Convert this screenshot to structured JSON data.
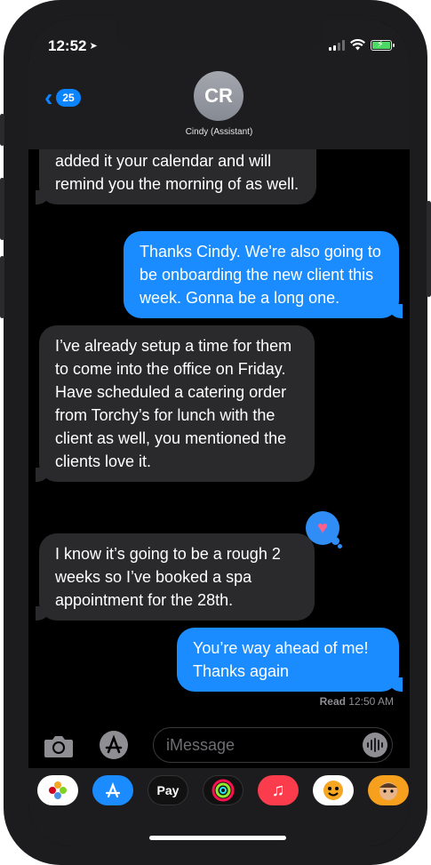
{
  "status_bar": {
    "time": "12:52",
    "location_icon": "location-arrow-icon",
    "battery_color": "#4cd964"
  },
  "header": {
    "back_badge": "25",
    "avatar_initials": "CR",
    "contact_name": "Cindy (Assistant)"
  },
  "messages": [
    {
      "direction": "incoming",
      "text": "added it your calendar and will remind you the morning of as well."
    },
    {
      "direction": "outgoing",
      "text": "Thanks Cindy. We're also going to be onboarding the new client this week. Gonna be a long one."
    },
    {
      "direction": "incoming",
      "text": "I’ve already setup a time for them to come into the office on Friday. Have scheduled a catering order from Torchy’s for lunch with the client as well, you mentioned the clients love it."
    },
    {
      "direction": "incoming",
      "text": "I know it’s going to be a rough 2 weeks so I’ve booked a spa appointment for the 28th.",
      "tapback": "heart-icon"
    },
    {
      "direction": "outgoing",
      "text": "You’re way ahead of me! Thanks again"
    }
  ],
  "read_receipt": {
    "label": "Read",
    "time": "12:50 AM"
  },
  "composer": {
    "placeholder": "iMessage"
  },
  "dock": {
    "apps": [
      {
        "name": "photos-app-icon",
        "label": "",
        "bg": "#ffffff",
        "fg": "#e94b3c"
      },
      {
        "name": "app-store-icon",
        "label": "",
        "bg": "#1a8cff",
        "fg": "#ffffff"
      },
      {
        "name": "apple-pay-icon",
        "label": "Pay",
        "bg": "#111111",
        "fg": "#ffffff"
      },
      {
        "name": "activity-icon",
        "label": "",
        "bg": "#111111",
        "fg": "#ffffff"
      },
      {
        "name": "music-icon",
        "label": "",
        "bg": "#fa3c4c",
        "fg": "#ffffff"
      },
      {
        "name": "animoji-icon",
        "label": "",
        "bg": "#ffffff",
        "fg": "#000000"
      },
      {
        "name": "memoji-icon",
        "label": "",
        "bg": "#f7a01e",
        "fg": "#000000"
      }
    ]
  },
  "colors": {
    "outgoing_bubble": "#1a8cff",
    "incoming_bubble": "#2a2a2c",
    "accent": "#0a84ff"
  }
}
